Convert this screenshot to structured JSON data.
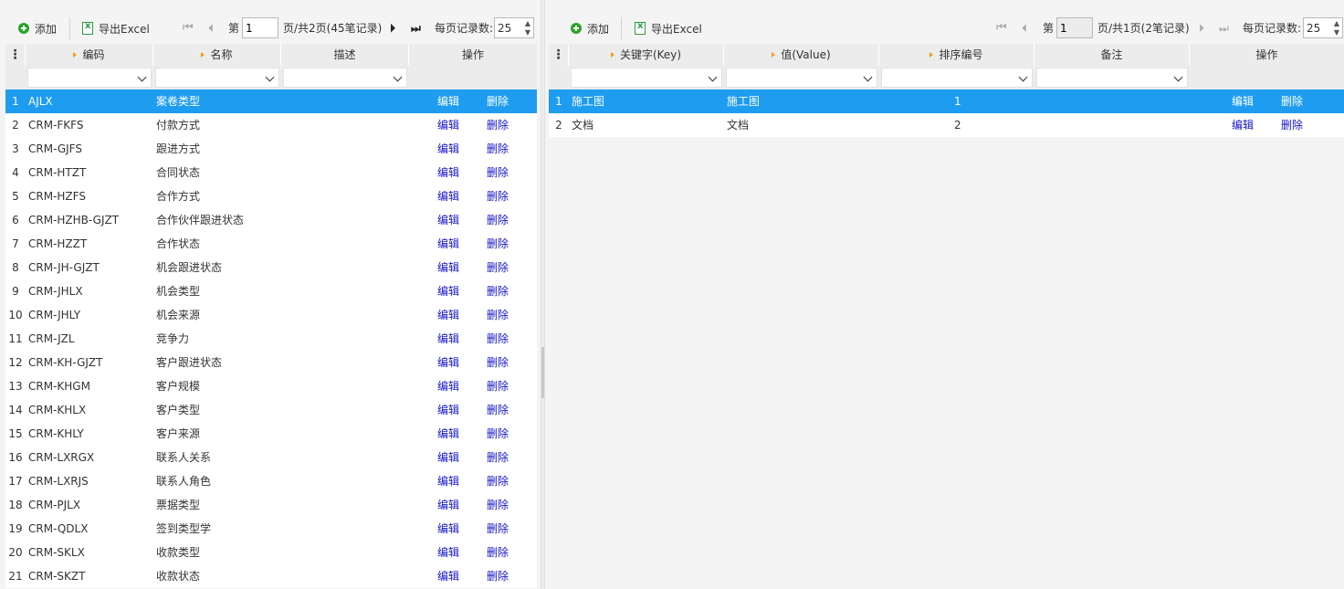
{
  "left": {
    "toolbar": {
      "add_label": "添加",
      "export_label": "导出Excel"
    },
    "pager": {
      "page_prefix": "第",
      "page_value": "1",
      "page_suffix": "页/共2页(45笔记录)",
      "per_page_label": "每页记录数:",
      "per_page_value": "25"
    },
    "columns": [
      "编码",
      "名称",
      "描述",
      "操作"
    ],
    "rows": [
      {
        "n": "1",
        "code": "AJLX",
        "name": "案卷类型"
      },
      {
        "n": "2",
        "code": "CRM-FKFS",
        "name": "付款方式"
      },
      {
        "n": "3",
        "code": "CRM-GJFS",
        "name": "跟进方式"
      },
      {
        "n": "4",
        "code": "CRM-HTZT",
        "name": "合同状态"
      },
      {
        "n": "5",
        "code": "CRM-HZFS",
        "name": "合作方式"
      },
      {
        "n": "6",
        "code": "CRM-HZHB-GJZT",
        "name": "合作伙伴跟进状态"
      },
      {
        "n": "7",
        "code": "CRM-HZZT",
        "name": "合作状态"
      },
      {
        "n": "8",
        "code": "CRM-JH-GJZT",
        "name": "机会跟进状态"
      },
      {
        "n": "9",
        "code": "CRM-JHLX",
        "name": "机会类型"
      },
      {
        "n": "10",
        "code": "CRM-JHLY",
        "name": "机会来源"
      },
      {
        "n": "11",
        "code": "CRM-JZL",
        "name": "竞争力"
      },
      {
        "n": "12",
        "code": "CRM-KH-GJZT",
        "name": "客户跟进状态"
      },
      {
        "n": "13",
        "code": "CRM-KHGM",
        "name": "客户规模"
      },
      {
        "n": "14",
        "code": "CRM-KHLX",
        "name": "客户类型"
      },
      {
        "n": "15",
        "code": "CRM-KHLY",
        "name": "客户来源"
      },
      {
        "n": "16",
        "code": "CRM-LXRGX",
        "name": "联系人关系"
      },
      {
        "n": "17",
        "code": "CRM-LXRJS",
        "name": "联系人角色"
      },
      {
        "n": "18",
        "code": "CRM-PJLX",
        "name": "票据类型"
      },
      {
        "n": "19",
        "code": "CRM-QDLX",
        "name": "签到类型学"
      },
      {
        "n": "20",
        "code": "CRM-SKLX",
        "name": "收款类型"
      },
      {
        "n": "21",
        "code": "CRM-SKZT",
        "name": "收款状态"
      }
    ],
    "edit_label": "编辑",
    "delete_label": "删除"
  },
  "right": {
    "toolbar": {
      "add_label": "添加",
      "export_label": "导出Excel"
    },
    "pager": {
      "page_prefix": "第",
      "page_value": "1",
      "page_suffix": "页/共1页(2笔记录)",
      "per_page_label": "每页记录数:",
      "per_page_value": "25"
    },
    "columns": [
      "关键字(Key)",
      "值(Value)",
      "排序编号",
      "备注",
      "操作"
    ],
    "rows": [
      {
        "n": "1",
        "key": "施工图",
        "value": "施工图",
        "order": "1"
      },
      {
        "n": "2",
        "key": "文档",
        "value": "文档",
        "order": "2"
      }
    ],
    "edit_label": "编辑",
    "delete_label": "删除"
  },
  "colors": {
    "selected_row": "#1e9cf0",
    "link": "#1515c8",
    "sort_arrow": "#f39a1b",
    "add_icon": "#2aa32a"
  }
}
